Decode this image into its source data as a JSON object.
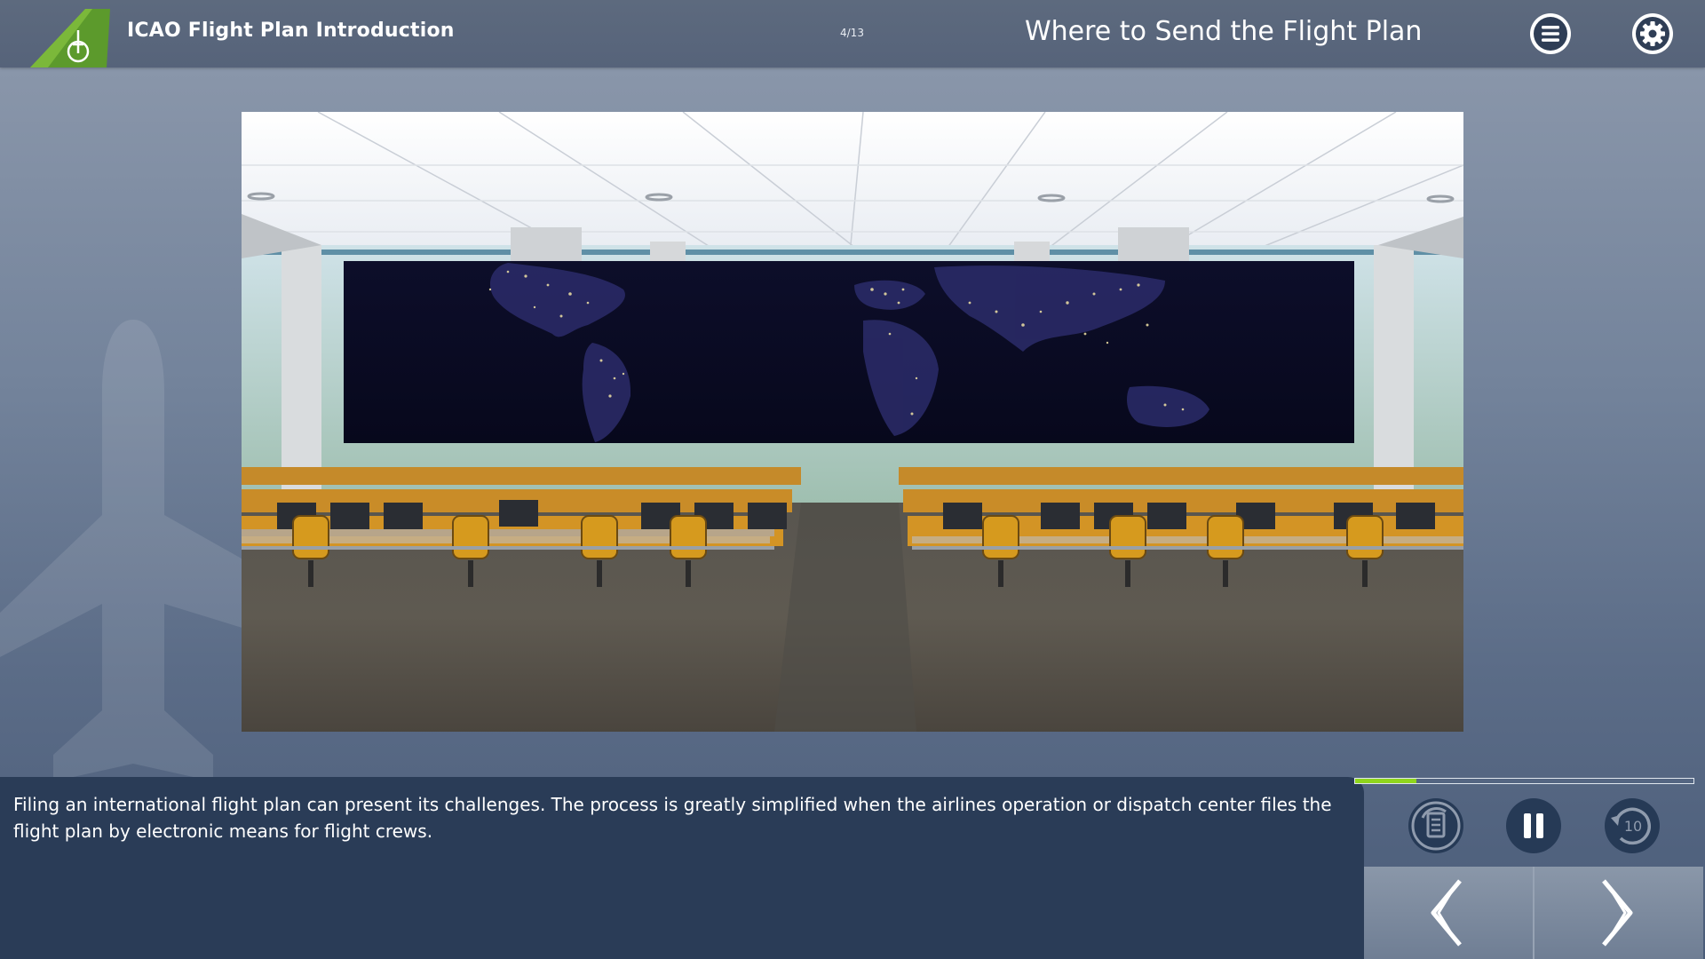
{
  "header": {
    "course_title": "ICAO Flight Plan Introduction",
    "page_counter": "4/13",
    "slide_title": "Where to Send the Flight Plan",
    "menu_icon": "menu-icon",
    "settings_icon": "gear-icon"
  },
  "scene": {
    "description_icon": "operations-center-image"
  },
  "transcript": {
    "text": "Filing an international flight plan can present its challenges. The process is greatly simplified when the airlines operation or dispatch center files the flight plan by electronic means for flight crews."
  },
  "playback": {
    "progress": 0.18,
    "progress_color": "#8fd61c",
    "transcript_icon": "transcript-icon",
    "pause_icon": "pause-icon",
    "replay_icon": "replay-10-icon",
    "replay_label": "10"
  },
  "navigation": {
    "prev_icon": "chevron-left-icon",
    "next_icon": "chevron-right-icon"
  },
  "colors": {
    "header": "#56637a",
    "transcript_panel": "#2a3c57",
    "accent_green": "#8fd61c",
    "logo_green": "#5c9a2c"
  }
}
